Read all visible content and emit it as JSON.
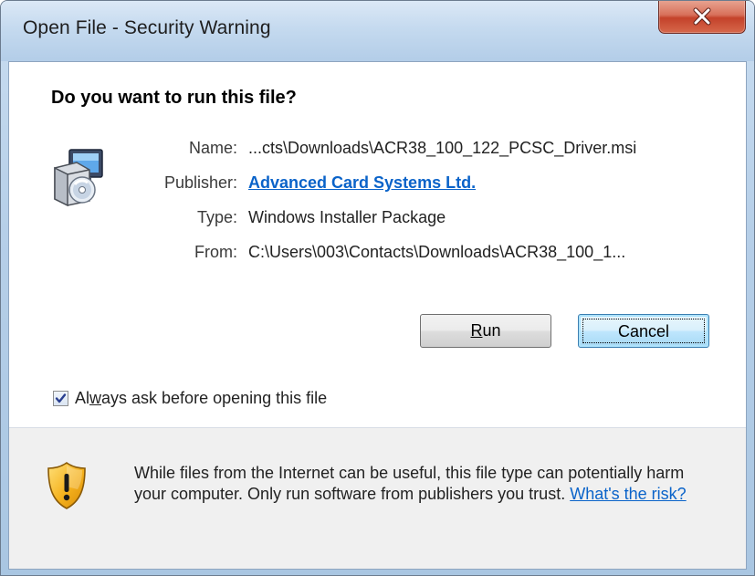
{
  "window": {
    "title": "Open File - Security Warning",
    "close_icon": "close-icon"
  },
  "dialog": {
    "heading": "Do you want to run this file?",
    "file_icon": "windows-installer-icon",
    "fields": {
      "name_label": "Name:",
      "name_value": "...cts\\Downloads\\ACR38_100_122_PCSC_Driver.msi",
      "publisher_label": "Publisher:",
      "publisher_value": "Advanced Card Systems Ltd.",
      "type_label": "Type:",
      "type_value": "Windows Installer Package",
      "from_label": "From:",
      "from_value": "C:\\Users\\003\\Contacts\\Downloads\\ACR38_100_1..."
    },
    "buttons": {
      "run_label_pre": "",
      "run_label_accel": "R",
      "run_label_post": "un",
      "cancel_label": "Cancel"
    },
    "checkbox": {
      "checked": true,
      "label_pre": "Al",
      "label_accel": "w",
      "label_post": "ays ask before opening this file"
    },
    "footer": {
      "shield_icon": "security-shield-icon",
      "text": "While files from the Internet can be useful, this file type can potentially harm your computer. Only run software from publishers you trust. ",
      "link": "What's the risk?"
    }
  },
  "colors": {
    "link": "#0a63c9",
    "close_button": "#c4422a",
    "footer_bg": "#f0f0f0"
  }
}
